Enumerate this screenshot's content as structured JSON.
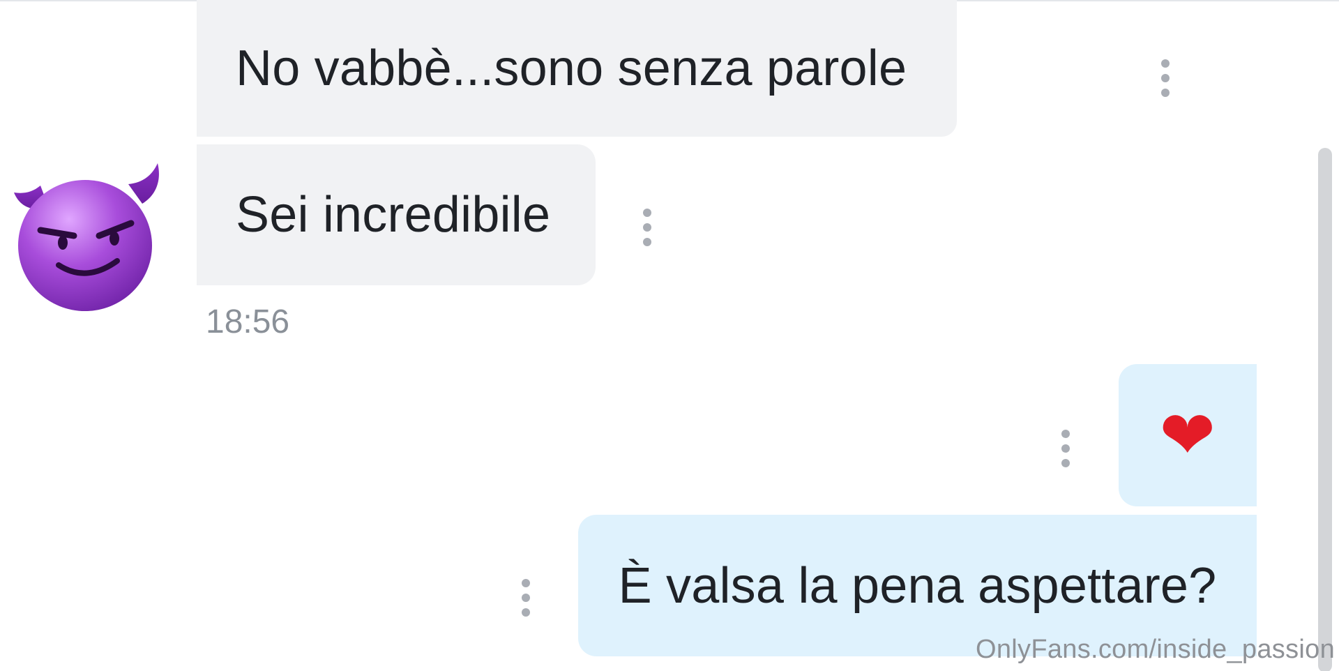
{
  "messages": [
    {
      "direction": "received",
      "text": "No vabbè...sono senza parole"
    },
    {
      "direction": "received",
      "text": "Sei incredibile"
    },
    {
      "direction": "sent",
      "text": "❤"
    },
    {
      "direction": "sent",
      "text": "È valsa la pena aspettare?"
    }
  ],
  "timestamp": "18:56",
  "avatar": {
    "icon": "smiling-devil-emoji-icon",
    "color": "#a24dd6"
  },
  "menu_icon": "more-vertical-icon",
  "watermark": "OnlyFans.com/inside_passion",
  "colors": {
    "received_bubble": "#f1f2f4",
    "sent_bubble": "#dff2fd",
    "heart": "#e41c27",
    "online_indicator": "#2fc25b"
  }
}
